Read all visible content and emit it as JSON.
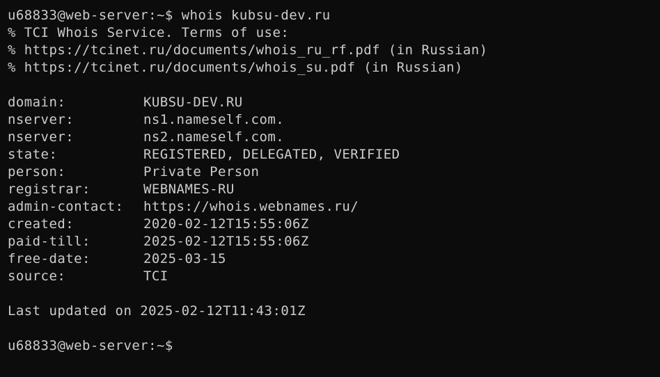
{
  "terminal": {
    "colors": {
      "background": "#0c0c0c",
      "foreground": "#cccccc"
    },
    "command": {
      "prompt": "u68833@web-server:~$",
      "text": "whois kubsu-dev.ru"
    },
    "header": [
      "% TCI Whois Service. Terms of use:",
      "% https://tcinet.ru/documents/whois_ru_rf.pdf (in Russian)",
      "% https://tcinet.ru/documents/whois_su.pdf (in Russian)"
    ],
    "records": [
      {
        "key": "domain:",
        "value": "KUBSU-DEV.RU"
      },
      {
        "key": "nserver:",
        "value": "ns1.nameself.com."
      },
      {
        "key": "nserver:",
        "value": "ns2.nameself.com."
      },
      {
        "key": "state:",
        "value": "REGISTERED, DELEGATED, VERIFIED"
      },
      {
        "key": "person:",
        "value": "Private Person"
      },
      {
        "key": "registrar:",
        "value": "WEBNAMES-RU"
      },
      {
        "key": "admin-contact:",
        "value": "https://whois.webnames.ru/"
      },
      {
        "key": "created:",
        "value": "2020-02-12T15:55:06Z"
      },
      {
        "key": "paid-till:",
        "value": "2025-02-12T15:55:06Z"
      },
      {
        "key": "free-date:",
        "value": "2025-03-15"
      },
      {
        "key": "source:",
        "value": "TCI"
      }
    ],
    "last_updated": "Last updated on 2025-02-12T11:43:01Z",
    "final_prompt": "u68833@web-server:~$"
  }
}
